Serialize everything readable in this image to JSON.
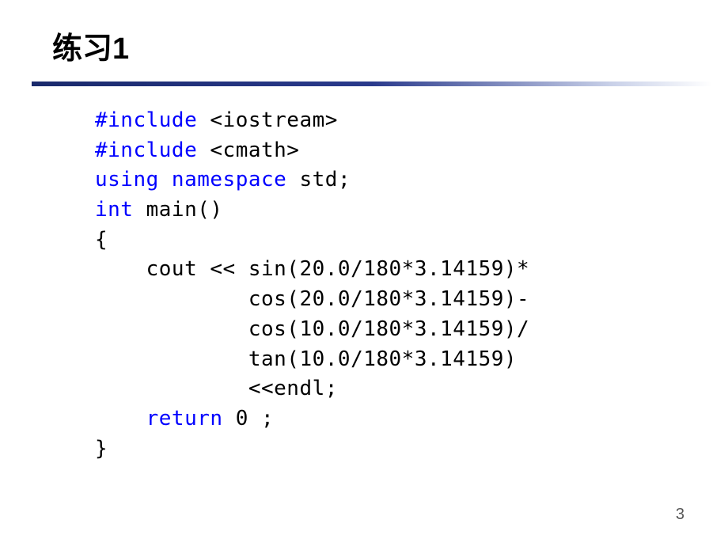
{
  "title": "练习1",
  "code": {
    "l1_kw": "#include",
    "l1_rest": " <iostream>",
    "l2_kw": "#include",
    "l2_rest": " <cmath>",
    "l3_kw1": "using",
    "l3_kw2": " namespace",
    "l3_rest": " std;",
    "l4_kw": "int",
    "l4_rest": " main()",
    "l5": "{",
    "l6": "    cout << sin(20.0/180*3.14159)*",
    "l7": "            cos(20.0/180*3.14159)-",
    "l8": "            cos(10.0/180*3.14159)/",
    "l9": "            tan(10.0/180*3.14159)",
    "l10": "            <<endl;",
    "l11_pre": "    ",
    "l11_kw": "return",
    "l11_rest": " 0 ;",
    "l12": "}"
  },
  "pageNumber": "3"
}
